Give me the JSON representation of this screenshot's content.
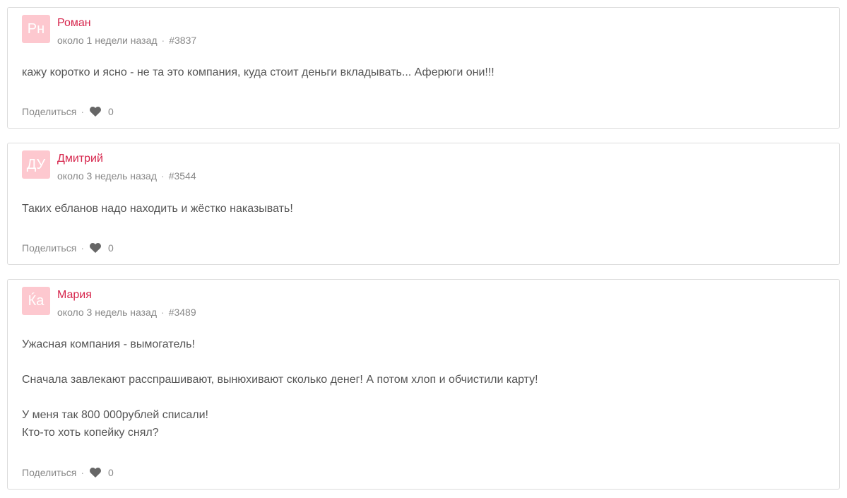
{
  "comments": [
    {
      "avatar_initials": "Рн",
      "author": "Роман",
      "time": "около 1 недели назад",
      "id": "#3837",
      "paragraphs": [
        "кажу коротко и ясно - не та это компания, куда стоит деньги вкладывать... Аферюги они!!!"
      ],
      "share_label": "Поделиться",
      "likes": "0"
    },
    {
      "avatar_initials": "ДУ",
      "author": "Дмитрий",
      "time": "около 3 недель назад",
      "id": "#3544",
      "paragraphs": [
        "Таких ебланов надо находить и жёстко наказывать!"
      ],
      "share_label": "Поделиться",
      "likes": "0"
    },
    {
      "avatar_initials": "Ќа",
      "author": "Мария",
      "time": "около 3 недель назад",
      "id": "#3489",
      "paragraphs": [
        "Ужасная компания - вымогатель!",
        "Сначала завлекают расспрашивают, вынюхивают сколько денег! А потом хлоп и обчистили карту!",
        "У меня так 800 000рублей списали!",
        "Кто-то хоть копейку снял?"
      ],
      "share_label": "Поделиться",
      "likes": "0"
    }
  ],
  "colors": {
    "author": "#d6244b",
    "avatar_bg": "#fdc8cf",
    "border": "#dcdcdc",
    "meta": "#888888",
    "text": "#555555",
    "heart": "#666666"
  },
  "icons": {
    "like": "heart-icon"
  }
}
